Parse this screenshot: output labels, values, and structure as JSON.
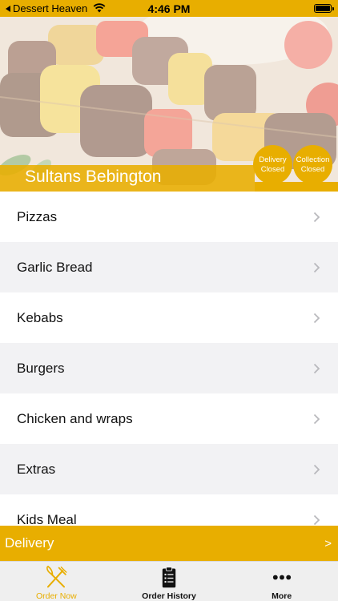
{
  "status_bar": {
    "back_app": "Dessert Heaven",
    "time": "4:46 PM"
  },
  "hero": {
    "restaurant_name": "Sultans Bebington",
    "delivery_status": {
      "line1": "Delivery",
      "line2": "Closed"
    },
    "collection_status": {
      "line1": "Collection",
      "line2": "Closed"
    }
  },
  "menu": {
    "categories": [
      {
        "label": "Pizzas"
      },
      {
        "label": "Garlic Bread"
      },
      {
        "label": "Kebabs"
      },
      {
        "label": "Burgers"
      },
      {
        "label": "Chicken and wraps"
      },
      {
        "label": "Extras"
      },
      {
        "label": "Kids Meal"
      }
    ]
  },
  "delivery_bar": {
    "label": "Delivery",
    "arrow": ">"
  },
  "tabs": [
    {
      "label": "Order Now",
      "icon": "fork-knife-icon",
      "active": true
    },
    {
      "label": "Order History",
      "icon": "clipboard-list-icon",
      "active": false
    },
    {
      "label": "More",
      "icon": "more-dots-icon",
      "active": false
    }
  ],
  "colors": {
    "accent": "#e8ae00",
    "row_alt": "#f2f2f4"
  }
}
